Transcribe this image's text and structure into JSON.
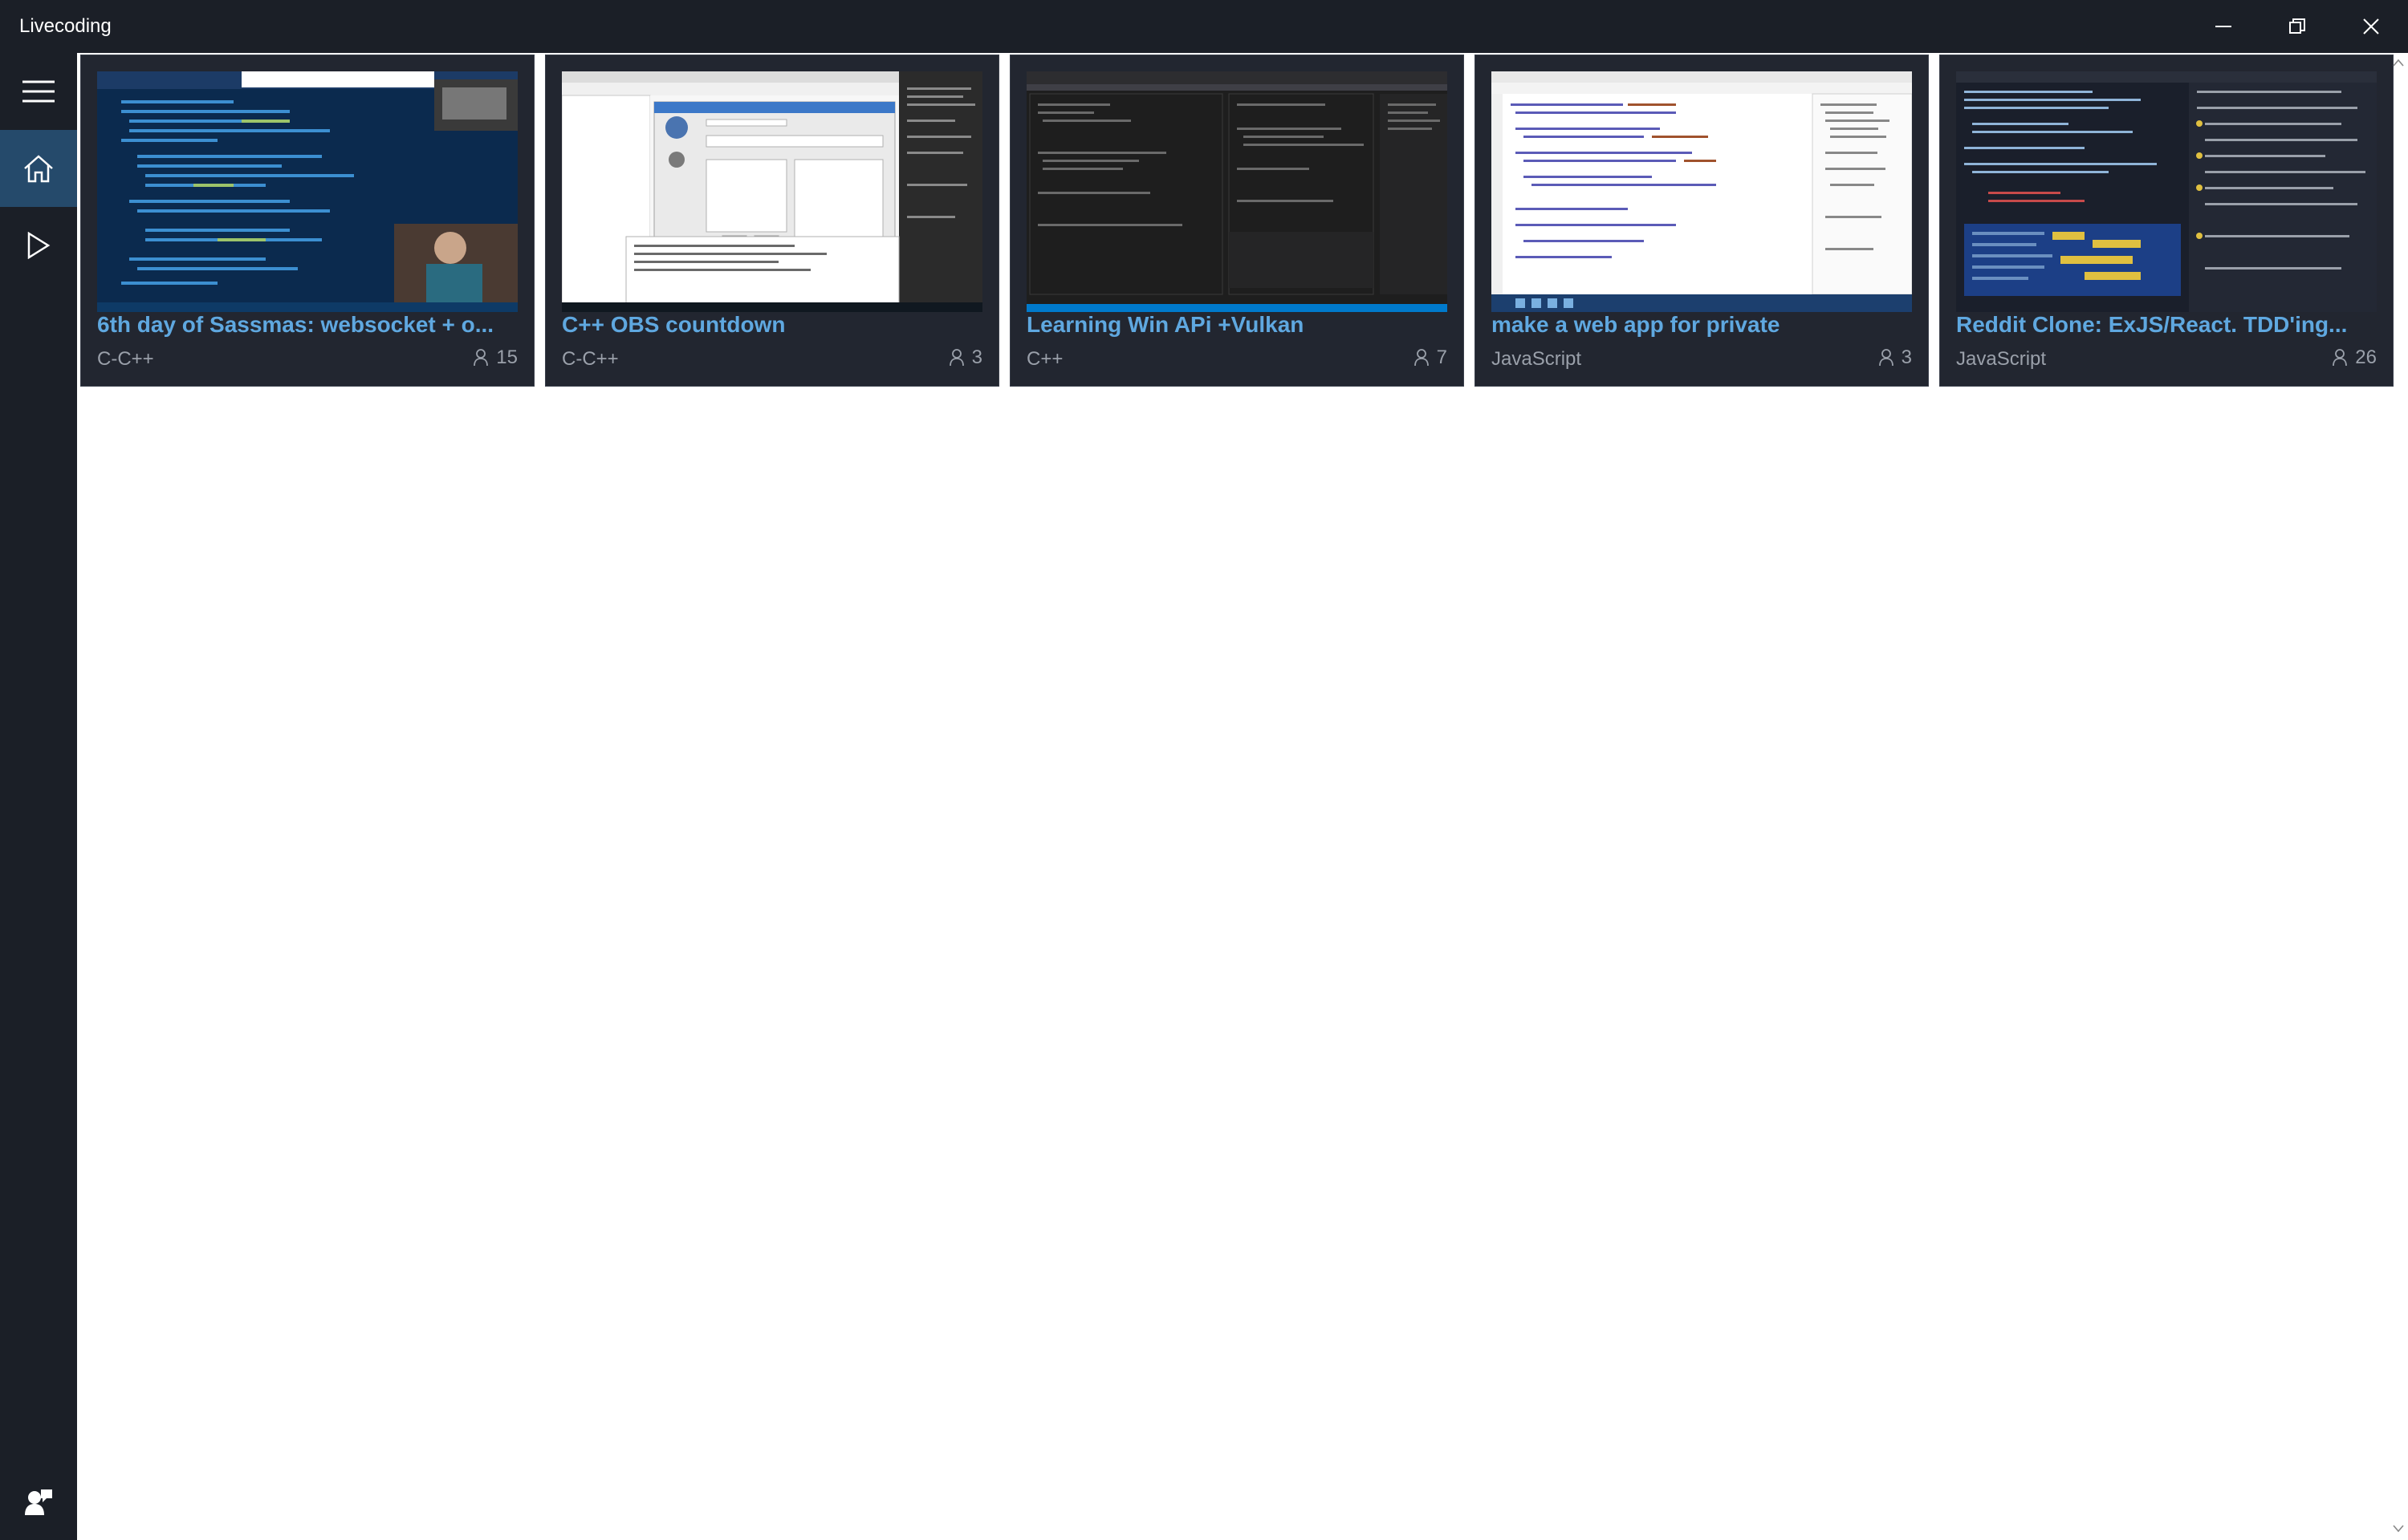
{
  "app": {
    "title": "Livecoding"
  },
  "window": {
    "minimize_icon": "minimize-icon",
    "restore_icon": "restore-icon",
    "close_icon": "close-icon"
  },
  "sidebar": {
    "items": [
      {
        "icon": "hamburger-menu-icon"
      },
      {
        "icon": "home-icon",
        "selected": true
      },
      {
        "icon": "play-icon"
      }
    ],
    "footer_icon": "user-profile-icon"
  },
  "colors": {
    "chrome_bg": "#1b1f27",
    "active_nav": "#254a6b",
    "card_bg": "#222630",
    "title_accent": "#5fa8e0",
    "muted_text": "#9aa0aa"
  },
  "streams": [
    {
      "title": "6th day of Sassmas: websocket + o...",
      "language": "C-C++",
      "viewers": "15"
    },
    {
      "title": "C++ OBS countdown",
      "language": "C-C++",
      "viewers": "3"
    },
    {
      "title": "Learning Win APi +Vulkan",
      "language": "C++",
      "viewers": "7"
    },
    {
      "title": "make a web app for private",
      "language": "JavaScript",
      "viewers": "3"
    },
    {
      "title": "Reddit Clone: ExJS/React. TDD'ing...",
      "language": "JavaScript",
      "viewers": "26"
    }
  ]
}
